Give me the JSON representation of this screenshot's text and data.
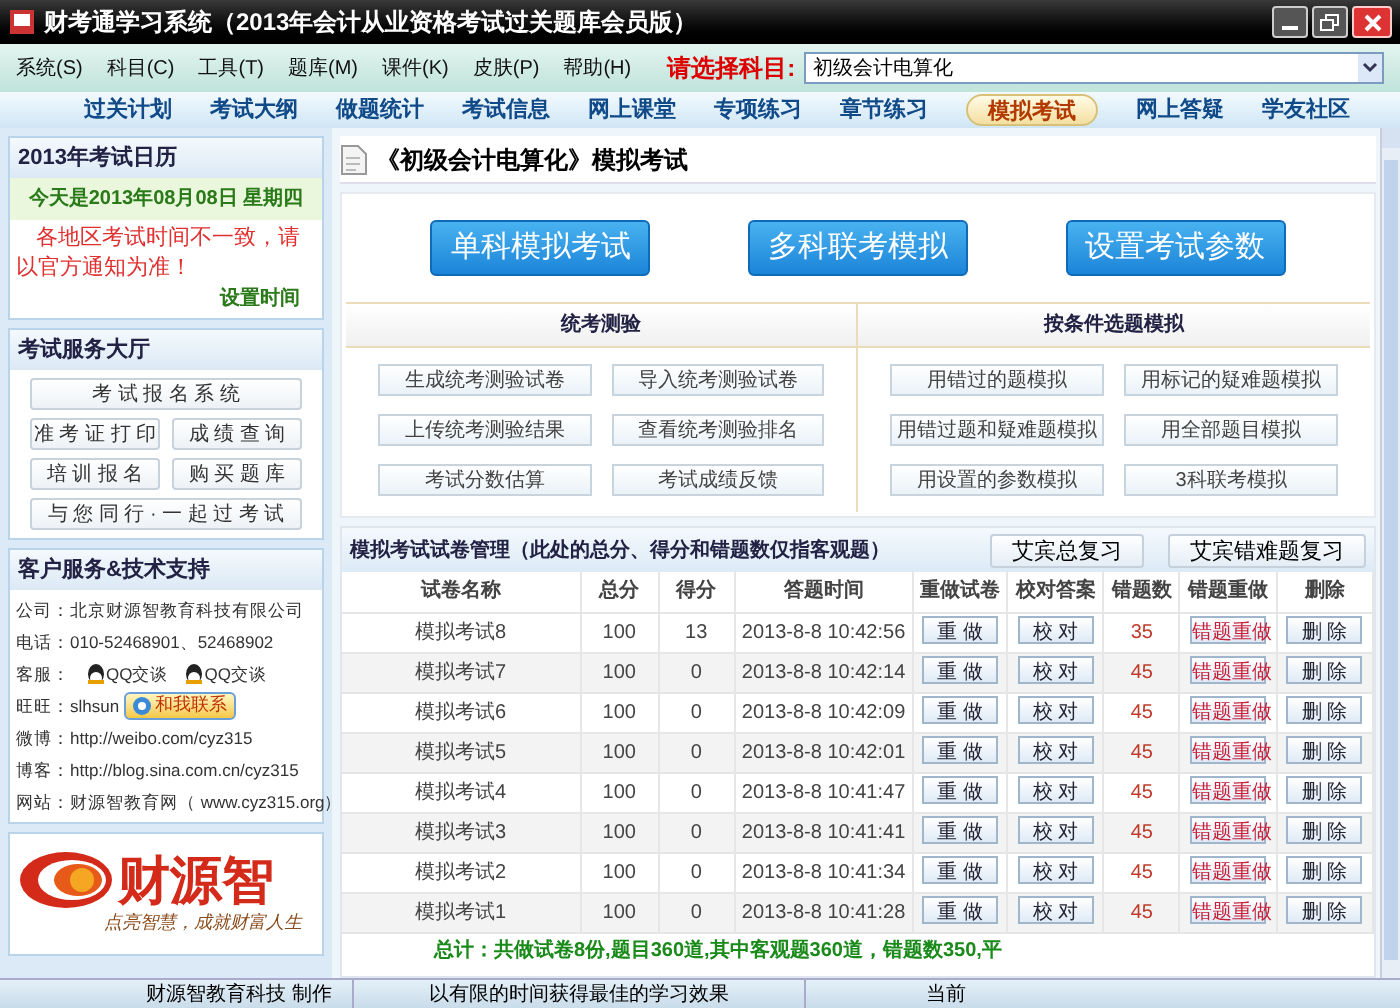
{
  "window": {
    "title": "财考通学习系统（2013年会计从业资格考试过关题库会员版）"
  },
  "menu": [
    "系统(S)",
    "科目(C)",
    "工具(T)",
    "题库(M)",
    "课件(K)",
    "皮肤(P)",
    "帮助(H)"
  ],
  "subject_picker": {
    "label": "请选择科目:",
    "value": "初级会计电算化"
  },
  "nav_tabs": [
    {
      "label": "过关计划",
      "selected": false
    },
    {
      "label": "考试大纲",
      "selected": false
    },
    {
      "label": "做题统计",
      "selected": false
    },
    {
      "label": "考试信息",
      "selected": false
    },
    {
      "label": "网上课堂",
      "selected": false
    },
    {
      "label": "专项练习",
      "selected": false
    },
    {
      "label": "章节练习",
      "selected": false
    },
    {
      "label": "模拟考试",
      "selected": true
    },
    {
      "label": "网上答疑",
      "selected": false
    },
    {
      "label": "学友社区",
      "selected": false
    }
  ],
  "calendar": {
    "title": "2013年考试日历",
    "today": "今天是2013年08月08日  星期四",
    "notice": "各地区考试时间不一致，请以官方通知为准！",
    "link": "设置时间"
  },
  "service_hall": {
    "title": "考试服务大厅",
    "buttons": [
      {
        "label": "考 试 报 名 系 统",
        "kind": "wide"
      },
      {
        "label": "准 考 证 打 印",
        "kind": "half"
      },
      {
        "label": "成 绩 查 询",
        "kind": "half"
      },
      {
        "label": "培 训 报 名",
        "kind": "half"
      },
      {
        "label": "购 买 题 库",
        "kind": "half"
      },
      {
        "label": "与 您 同 行 · 一 起 过 考 试",
        "kind": "wide"
      }
    ]
  },
  "support": {
    "title": "客户服务&技术支持",
    "items": [
      {
        "kind": "text",
        "label": "公司：",
        "value": "北京财源智教育科技有限公司"
      },
      {
        "kind": "text",
        "label": "电话：",
        "value": "010-52468901、52468902"
      },
      {
        "kind": "qq",
        "label": "客服：",
        "badges": [
          "QQ交谈",
          "QQ交谈"
        ]
      },
      {
        "kind": "wangwang",
        "label": "旺旺：",
        "value": "slhsun",
        "button": "和我联系"
      },
      {
        "kind": "text",
        "label": "微博：",
        "value": "http://weibo.com/cyz315"
      },
      {
        "kind": "text",
        "label": "博客：",
        "value": "http://blog.sina.com.cn/cyz315"
      },
      {
        "kind": "text",
        "label": "网站：",
        "value": "财源智教育网（ www.cyz315.org）"
      }
    ]
  },
  "logo": {
    "name": "财源智",
    "slogan": "点亮智慧，成就财富人生"
  },
  "page_title": "《初级会计电算化》模拟考试",
  "main_buttons": [
    "单科模拟考试",
    "多科联考模拟",
    "设置考试参数"
  ],
  "sections": [
    {
      "title": "统考测验",
      "buttons": [
        "生成统考测验试卷",
        "导入统考测验试卷",
        "上传统考测验结果",
        "查看统考测验排名",
        "考试分数估算",
        "考试成绩反馈"
      ]
    },
    {
      "title": "按条件选题模拟",
      "buttons": [
        "用错过的题模拟",
        "用标记的疑难题模拟",
        "用错过题和疑难题模拟",
        "用全部题目模拟",
        "用设置的参数模拟",
        "3科联考模拟"
      ]
    }
  ],
  "exam_table": {
    "title": "模拟考试试卷管理（此处的总分、得分和错题数仅指客观题）",
    "review_buttons": [
      "艾宾总复习",
      "艾宾错难题复习"
    ],
    "columns": [
      "试卷名称",
      "总分",
      "得分",
      "答题时间",
      "重做试卷",
      "校对答案",
      "错题数",
      "错题重做",
      "删除"
    ],
    "rows": [
      [
        "模拟考试8",
        "100",
        "13",
        "2013-8-8 10:42:56",
        "重 做",
        "校 对",
        "35",
        "错题重做",
        "删 除"
      ],
      [
        "模拟考试7",
        "100",
        "0",
        "2013-8-8 10:42:14",
        "重 做",
        "校 对",
        "45",
        "错题重做",
        "删 除"
      ],
      [
        "模拟考试6",
        "100",
        "0",
        "2013-8-8 10:42:09",
        "重 做",
        "校 对",
        "45",
        "错题重做",
        "删 除"
      ],
      [
        "模拟考试5",
        "100",
        "0",
        "2013-8-8 10:42:01",
        "重 做",
        "校 对",
        "45",
        "错题重做",
        "删 除"
      ],
      [
        "模拟考试4",
        "100",
        "0",
        "2013-8-8 10:41:47",
        "重 做",
        "校 对",
        "45",
        "错题重做",
        "删 除"
      ],
      [
        "模拟考试3",
        "100",
        "0",
        "2013-8-8 10:41:41",
        "重 做",
        "校 对",
        "45",
        "错题重做",
        "删 除"
      ],
      [
        "模拟考试2",
        "100",
        "0",
        "2013-8-8 10:41:34",
        "重 做",
        "校 对",
        "45",
        "错题重做",
        "删 除"
      ],
      [
        "模拟考试1",
        "100",
        "0",
        "2013-8-8 10:41:28",
        "重 做",
        "校 对",
        "45",
        "错题重做",
        "删 除"
      ]
    ],
    "summary": "总计：共做试卷8份,题目360道,其中客观题360道，错题数350,平"
  },
  "status_bar": [
    "财源智教育科技 制作",
    "以有限的时间获得最佳的学习效果",
    "当前"
  ]
}
